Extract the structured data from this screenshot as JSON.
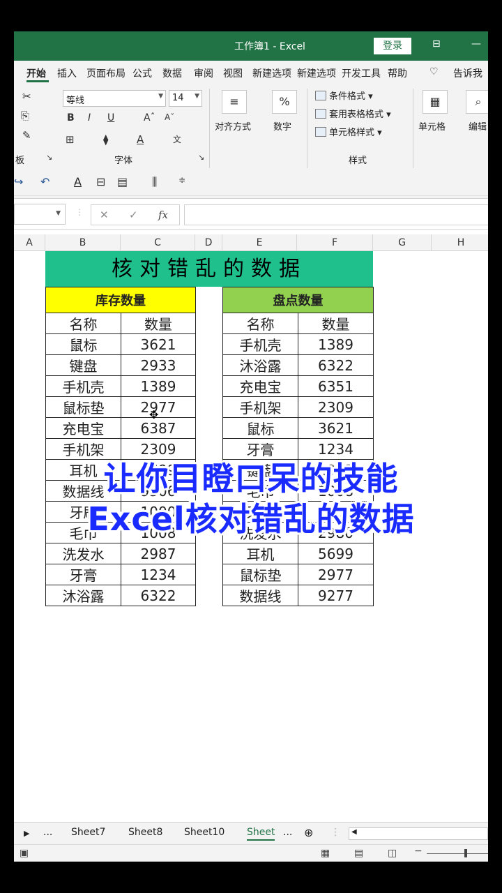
{
  "titlebar": {
    "title": "工作簿1  -  Excel",
    "login": "登录"
  },
  "tabs": [
    "开始",
    "插入",
    "页面布局",
    "公式",
    "数据",
    "审阅",
    "视图",
    "新建选项",
    "新建选项",
    "开发工具",
    "帮助",
    "告诉我"
  ],
  "ribbon": {
    "font_name": "等线",
    "font_size": "14",
    "clipboard_label": "板",
    "font_group": "字体",
    "align": "对齐方式",
    "number": "数字",
    "number_symbol": "%",
    "conditional": "条件格式",
    "table_format": "套用表格格式",
    "cell_styles": "单元格样式",
    "styles_group": "样式",
    "cells": "单元格",
    "edit": "编辑"
  },
  "formula": {
    "fx": "fx",
    "cancel": "✕",
    "enter": "✓"
  },
  "columns": [
    "A",
    "B",
    "C",
    "D",
    "E",
    "F",
    "G",
    "H"
  ],
  "banner": "核对错乱的数据",
  "left_table": {
    "header": "库存数量",
    "col1": "名称",
    "col2": "数量",
    "rows": [
      [
        "鼠标",
        "3621"
      ],
      [
        "键盘",
        "2933"
      ],
      [
        "手机壳",
        "1389"
      ],
      [
        "鼠标垫",
        "2977"
      ],
      [
        "充电宝",
        "6387"
      ],
      [
        "手机架",
        "2309"
      ],
      [
        "耳机",
        "5699"
      ],
      [
        "数据线",
        "9306"
      ],
      [
        "牙刷",
        "1000"
      ],
      [
        "毛巾",
        "1008"
      ],
      [
        "洗发水",
        "2987"
      ],
      [
        "牙膏",
        "1234"
      ],
      [
        "沐浴露",
        "6322"
      ]
    ]
  },
  "right_table": {
    "header": "盘点数量",
    "col1": "名称",
    "col2": "数量",
    "rows": [
      [
        "手机壳",
        "1389"
      ],
      [
        "沐浴露",
        "6322"
      ],
      [
        "充电宝",
        "6351"
      ],
      [
        "手机架",
        "2309"
      ],
      [
        "鼠标",
        "3621"
      ],
      [
        "牙膏",
        "1234"
      ],
      [
        "键盘",
        "2933"
      ],
      [
        "毛巾",
        "1008"
      ],
      [
        "牙刷",
        "1000"
      ],
      [
        "洗发水",
        "2980"
      ],
      [
        "耳机",
        "5699"
      ],
      [
        "鼠标垫",
        "2977"
      ],
      [
        "数据线",
        "9277"
      ]
    ]
  },
  "overlay": {
    "line1": "让你目瞪口呆的技能",
    "line2": "Excel核对错乱的数据"
  },
  "sheet_tabs": [
    "...",
    "Sheet7",
    "Sheet8",
    "Sheet10",
    "Sheet",
    "..."
  ]
}
